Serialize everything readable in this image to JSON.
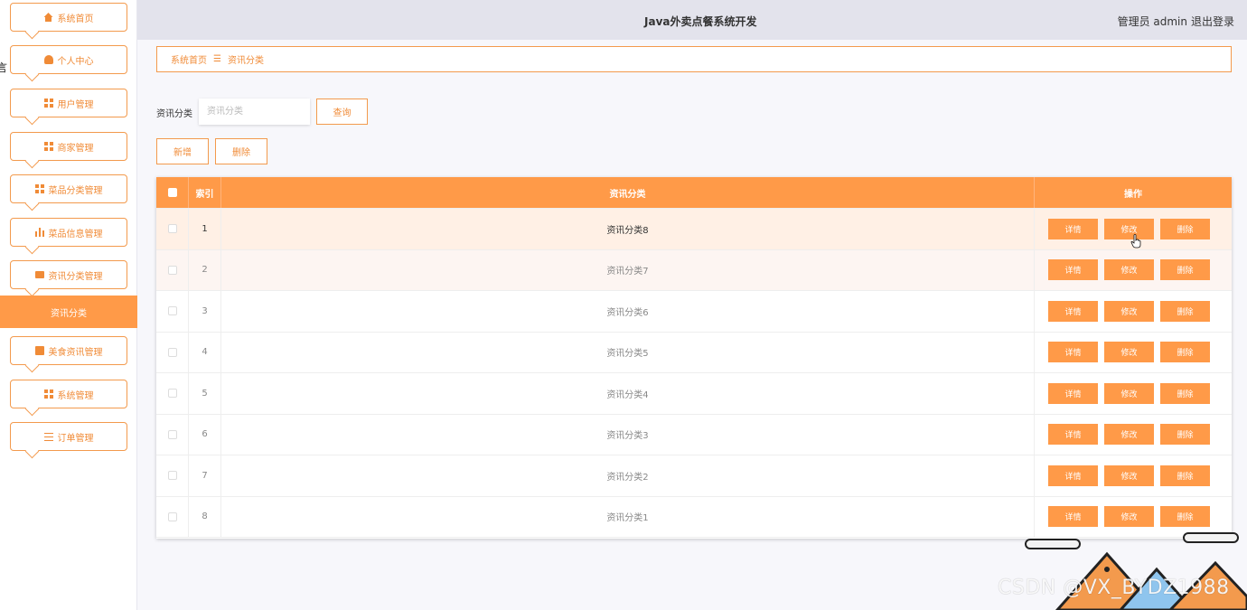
{
  "header": {
    "title": "Java外卖点餐系统开发",
    "admin_label": "管理员 admin",
    "logout": "退出登录"
  },
  "sidebar": {
    "stray_text": "言",
    "items": [
      {
        "label": "系统首页",
        "icon": "home-icon"
      },
      {
        "label": "个人中心",
        "icon": "user-icon"
      },
      {
        "label": "用户管理",
        "icon": "grid-icon"
      },
      {
        "label": "商家管理",
        "icon": "grid-icon"
      },
      {
        "label": "菜品分类管理",
        "icon": "grid-icon"
      },
      {
        "label": "菜品信息管理",
        "icon": "chart-icon"
      },
      {
        "label": "资讯分类管理",
        "icon": "monitor-icon"
      },
      {
        "label": "美食资讯管理",
        "icon": "clipboard-icon"
      },
      {
        "label": "系统管理",
        "icon": "grid-icon"
      },
      {
        "label": "订单管理",
        "icon": "sliders-icon"
      }
    ],
    "active_sub": "资讯分类"
  },
  "breadcrumb": {
    "home": "系统首页",
    "separator": "☰",
    "current": "资讯分类"
  },
  "search": {
    "label": "资讯分类",
    "placeholder": "资讯分类",
    "value": "",
    "button": "查询"
  },
  "actions": {
    "add": "新增",
    "delete": "删除"
  },
  "table": {
    "headers": {
      "index": "索引",
      "name": "资讯分类",
      "ops": "操作"
    },
    "op_labels": {
      "detail": "详情",
      "edit": "修改",
      "delete": "删除"
    },
    "rows": [
      {
        "index": "1",
        "name": "资讯分类8"
      },
      {
        "index": "2",
        "name": "资讯分类7"
      },
      {
        "index": "3",
        "name": "资讯分类6"
      },
      {
        "index": "4",
        "name": "资讯分类5"
      },
      {
        "index": "5",
        "name": "资讯分类4"
      },
      {
        "index": "6",
        "name": "资讯分类3"
      },
      {
        "index": "7",
        "name": "资讯分类2"
      },
      {
        "index": "8",
        "name": "资讯分类1"
      }
    ]
  },
  "watermark": "CSDN @VX_BYDZ1988",
  "colors": {
    "accent": "#ff9a48",
    "accent_text": "#f08b37",
    "header_bg": "#e3e3ec"
  }
}
